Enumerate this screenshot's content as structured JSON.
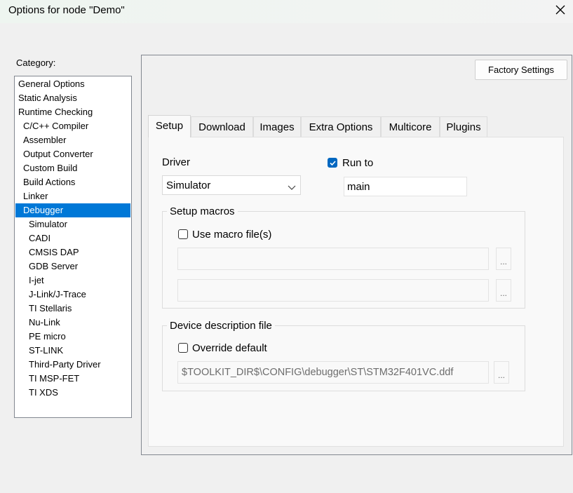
{
  "window": {
    "title": "Options for node \"Demo\""
  },
  "category": {
    "label": "Category:",
    "items": [
      "General Options",
      "Static Analysis",
      "Runtime Checking",
      "C/C++ Compiler",
      "Assembler",
      "Output Converter",
      "Custom Build",
      "Build Actions",
      "Linker",
      "Debugger",
      "Simulator",
      "CADI",
      "CMSIS DAP",
      "GDB Server",
      "I-jet",
      "J-Link/J-Trace",
      "TI Stellaris",
      "Nu-Link",
      "PE micro",
      "ST-LINK",
      "Third-Party Driver",
      "TI MSP-FET",
      "TI XDS"
    ],
    "selected": "Debugger"
  },
  "factory_settings_label": "Factory Settings",
  "tabs": [
    "Setup",
    "Download",
    "Images",
    "Extra Options",
    "Multicore",
    "Plugins"
  ],
  "active_tab": "Setup",
  "setup": {
    "driver_label": "Driver",
    "driver_value": "Simulator",
    "run_to_label": "Run to",
    "run_to_checked": true,
    "run_to_value": "main",
    "setup_macros_title": "Setup macros",
    "use_macro_label": "Use macro file(s)",
    "use_macro_checked": false,
    "macro_file_1": "",
    "macro_file_2": "",
    "device_desc_title": "Device description file",
    "override_label": "Override default",
    "override_checked": false,
    "device_desc_path": "$TOOLKIT_DIR$\\CONFIG\\debugger\\ST\\STM32F401VC.ddf",
    "ellipsis": "..."
  },
  "colors": {
    "selection": "#0078d7",
    "checkbox_checked": "#0067c0"
  }
}
